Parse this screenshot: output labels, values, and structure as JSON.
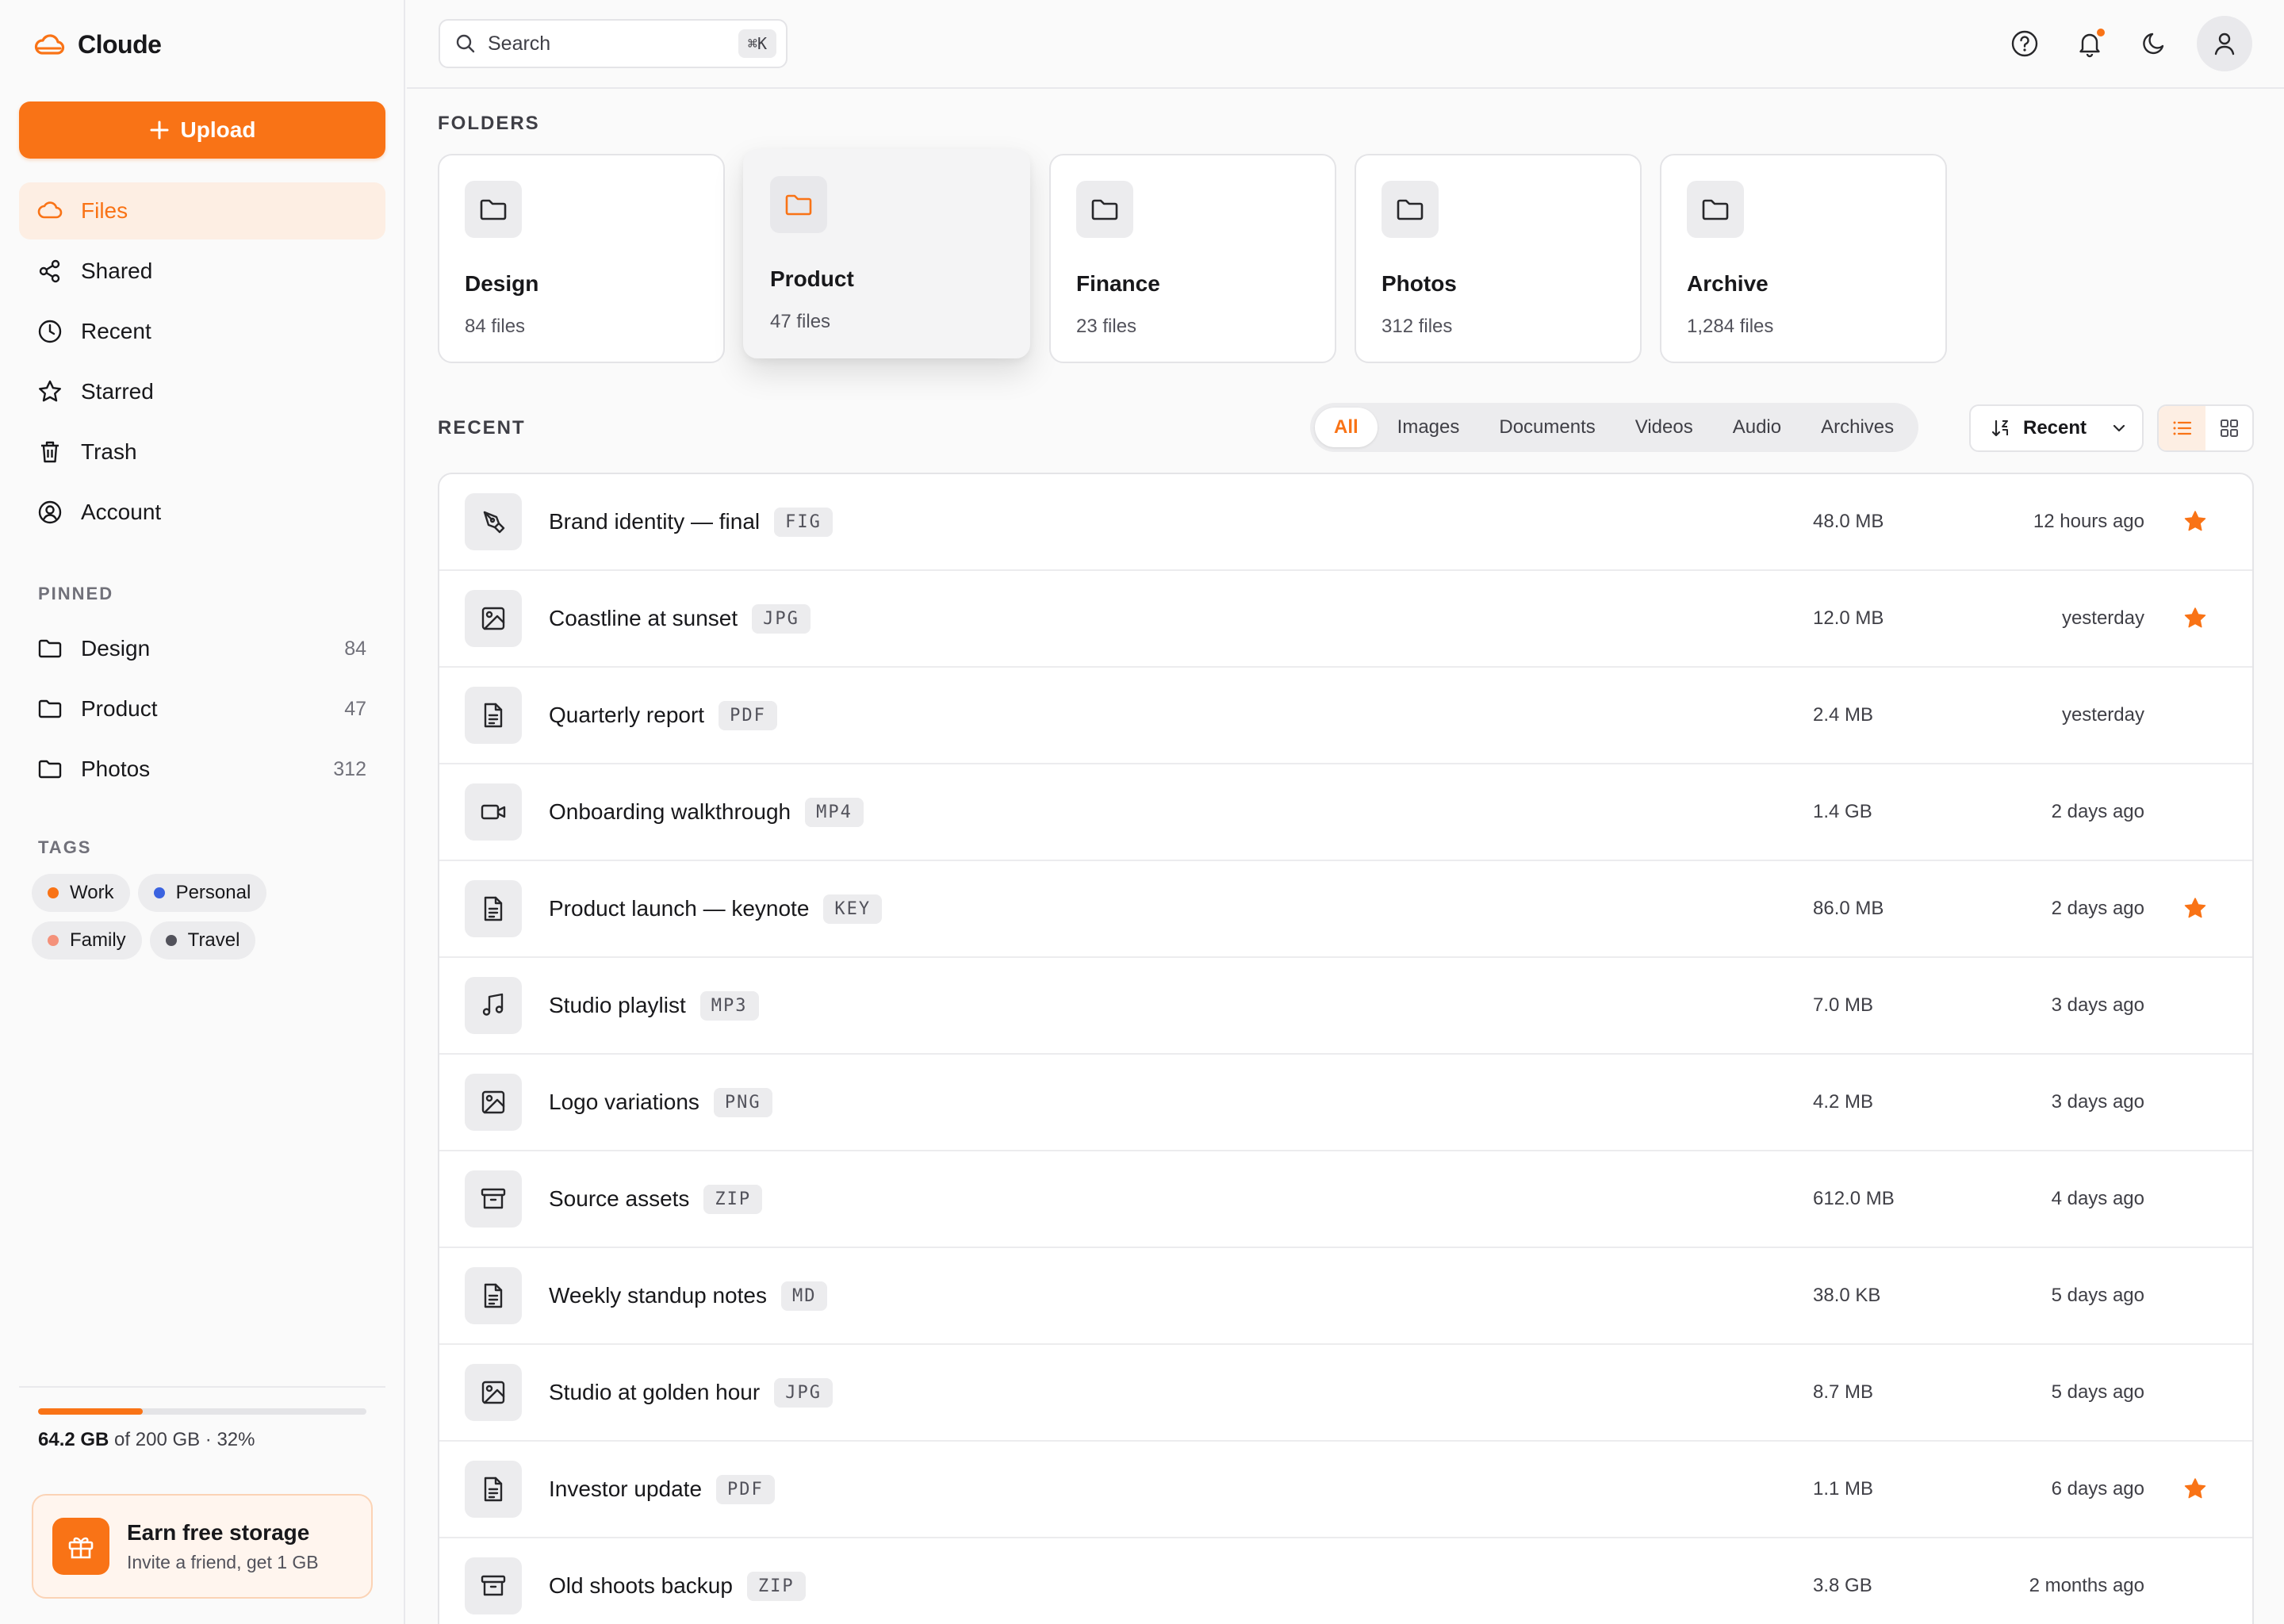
{
  "app": {
    "name": "Cloude"
  },
  "sidebar": {
    "upload_label": "Upload",
    "nav": [
      {
        "label": "Files",
        "icon": "cloud-icon",
        "active": true
      },
      {
        "label": "Shared",
        "icon": "share-icon",
        "active": false
      },
      {
        "label": "Recent",
        "icon": "clock-icon",
        "active": false
      },
      {
        "label": "Starred",
        "icon": "star-icon",
        "active": false
      },
      {
        "label": "Trash",
        "icon": "trash-icon",
        "active": false
      },
      {
        "label": "Account",
        "icon": "user-circle-icon",
        "active": false
      }
    ],
    "pinned_label": "PINNED",
    "pinned": [
      {
        "label": "Design",
        "count": "84"
      },
      {
        "label": "Product",
        "count": "47"
      },
      {
        "label": "Photos",
        "count": "312"
      }
    ],
    "tags_label": "TAGS",
    "tags": [
      {
        "label": "Work",
        "color": "#f97316"
      },
      {
        "label": "Personal",
        "color": "#3b63e0"
      },
      {
        "label": "Family",
        "color": "#f4917a"
      },
      {
        "label": "Travel",
        "color": "#52525b"
      }
    ],
    "storage": {
      "used": "64.2 GB",
      "rest": " of 200 GB · 32%",
      "percent": 32
    },
    "promo": {
      "title": "Earn free storage",
      "subtitle": "Invite a friend, get 1 GB"
    }
  },
  "topbar": {
    "search_placeholder": "Search",
    "search_shortcut": "⌘K",
    "icons": [
      "help-icon",
      "bell-icon",
      "moon-icon",
      "user-icon"
    ]
  },
  "folders": {
    "heading": "FOLDERS",
    "items": [
      {
        "name": "Design",
        "count": "84 files",
        "raised": false
      },
      {
        "name": "Product",
        "count": "47 files",
        "raised": true
      },
      {
        "name": "Finance",
        "count": "23 files",
        "raised": false
      },
      {
        "name": "Photos",
        "count": "312 files",
        "raised": false
      },
      {
        "name": "Archive",
        "count": "1,284 files",
        "raised": false
      }
    ]
  },
  "recent": {
    "heading": "RECENT",
    "filters": [
      "All",
      "Images",
      "Documents",
      "Videos",
      "Audio",
      "Archives"
    ],
    "active_filter": "All",
    "sort_label": "Recent",
    "files": [
      {
        "name": "Brand identity — final",
        "ext": "FIG",
        "size": "48.0 MB",
        "date": "12 hours ago",
        "starred": true,
        "icon": "pen-tool-icon"
      },
      {
        "name": "Coastline at sunset",
        "ext": "JPG",
        "size": "12.0 MB",
        "date": "yesterday",
        "starred": true,
        "icon": "image-icon"
      },
      {
        "name": "Quarterly report",
        "ext": "PDF",
        "size": "2.4 MB",
        "date": "yesterday",
        "starred": false,
        "icon": "document-icon"
      },
      {
        "name": "Onboarding walkthrough",
        "ext": "MP4",
        "size": "1.4 GB",
        "date": "2 days ago",
        "starred": false,
        "icon": "video-icon"
      },
      {
        "name": "Product launch — keynote",
        "ext": "KEY",
        "size": "86.0 MB",
        "date": "2 days ago",
        "starred": true,
        "icon": "document-icon"
      },
      {
        "name": "Studio playlist",
        "ext": "MP3",
        "size": "7.0 MB",
        "date": "3 days ago",
        "starred": false,
        "icon": "music-icon"
      },
      {
        "name": "Logo variations",
        "ext": "PNG",
        "size": "4.2 MB",
        "date": "3 days ago",
        "starred": false,
        "icon": "image-icon"
      },
      {
        "name": "Source assets",
        "ext": "ZIP",
        "size": "612.0 MB",
        "date": "4 days ago",
        "starred": false,
        "icon": "archive-icon"
      },
      {
        "name": "Weekly standup notes",
        "ext": "MD",
        "size": "38.0 KB",
        "date": "5 days ago",
        "starred": false,
        "icon": "document-icon"
      },
      {
        "name": "Studio at golden hour",
        "ext": "JPG",
        "size": "8.7 MB",
        "date": "5 days ago",
        "starred": false,
        "icon": "image-icon"
      },
      {
        "name": "Investor update",
        "ext": "PDF",
        "size": "1.1 MB",
        "date": "6 days ago",
        "starred": true,
        "icon": "document-icon"
      },
      {
        "name": "Old shoots backup",
        "ext": "ZIP",
        "size": "3.8 GB",
        "date": "2 months ago",
        "starred": false,
        "icon": "archive-icon"
      }
    ]
  },
  "colors": {
    "accent": "#f97316",
    "accent_soft": "#fdeee3",
    "star": "#f97316"
  }
}
